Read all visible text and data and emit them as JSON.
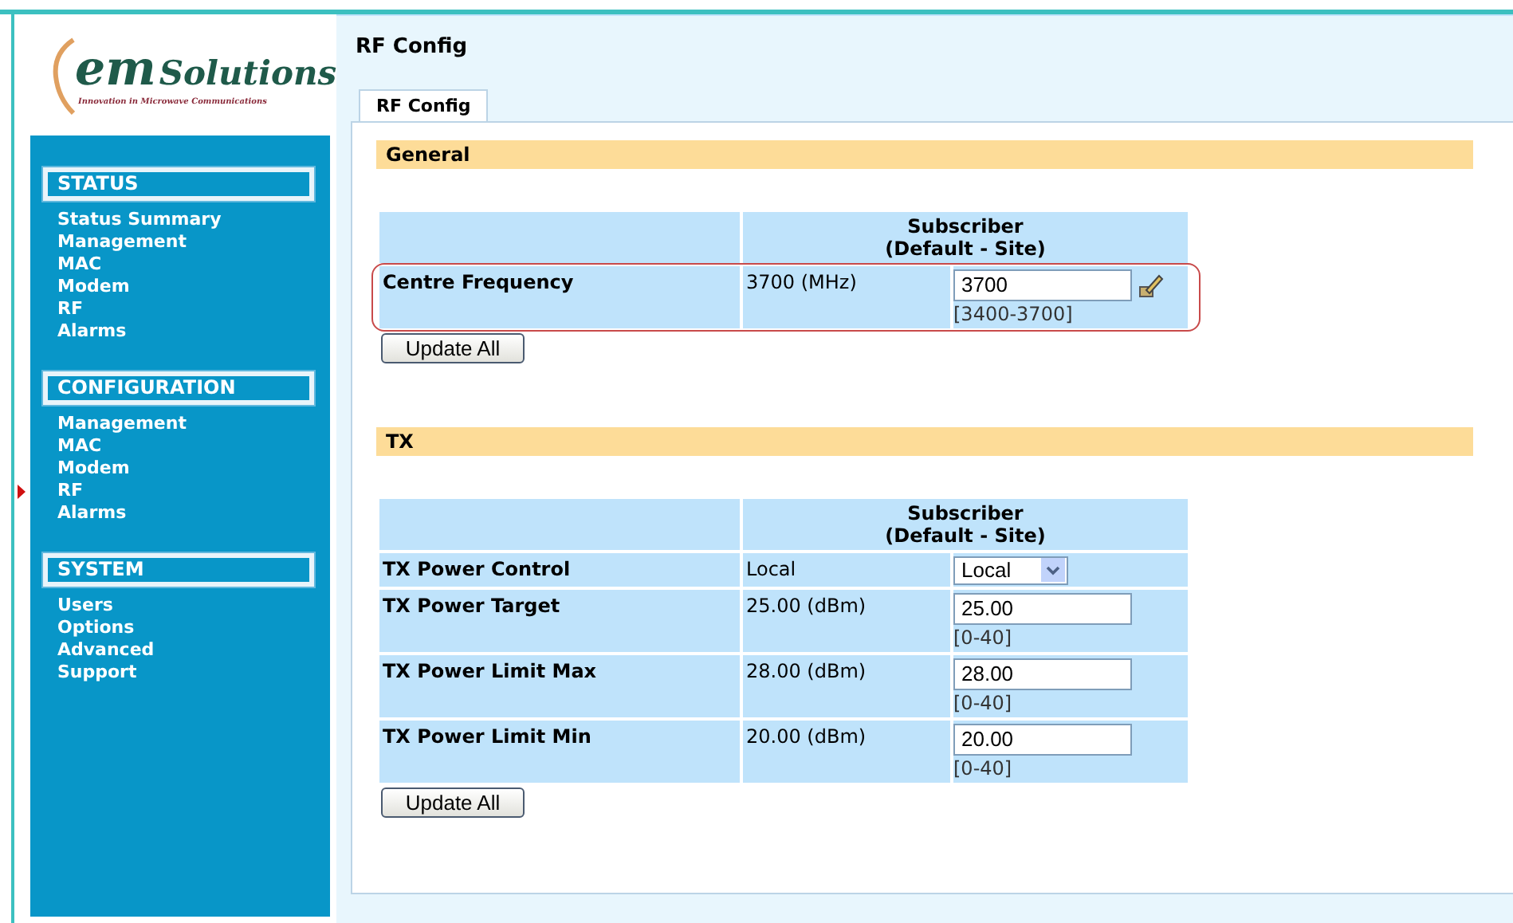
{
  "logo": {
    "brand_mark": "em",
    "brand_name": "Solutions",
    "tagline": "Innovation in Microwave Communications"
  },
  "sidebar": {
    "sections": [
      {
        "title": "STATUS",
        "items": [
          {
            "label": "Status Summary",
            "selected": false
          },
          {
            "label": "Management",
            "selected": false
          },
          {
            "label": "MAC",
            "selected": false
          },
          {
            "label": "Modem",
            "selected": false
          },
          {
            "label": "RF",
            "selected": false
          },
          {
            "label": "Alarms",
            "selected": false
          }
        ]
      },
      {
        "title": "CONFIGURATION",
        "items": [
          {
            "label": "Management",
            "selected": false
          },
          {
            "label": "MAC",
            "selected": false
          },
          {
            "label": "Modem",
            "selected": false
          },
          {
            "label": "RF",
            "selected": true
          },
          {
            "label": "Alarms",
            "selected": false
          }
        ]
      },
      {
        "title": "SYSTEM",
        "items": [
          {
            "label": "Users",
            "selected": false
          },
          {
            "label": "Options",
            "selected": false
          },
          {
            "label": "Advanced",
            "selected": false
          },
          {
            "label": "Support",
            "selected": false
          }
        ]
      }
    ]
  },
  "page_title": "RF Config",
  "tabs": [
    {
      "label": "RF Config",
      "selected": true
    }
  ],
  "sections": [
    {
      "title": "General",
      "column_header": "Subscriber\n(Default - Site)",
      "highlighted": true,
      "rows": [
        {
          "kind": "input",
          "label": "Centre Frequency",
          "current": "3700 (MHz)",
          "value": "3700",
          "range": "[3400-3700]",
          "edit_icon": true
        }
      ],
      "button": "Update All"
    },
    {
      "title": "TX",
      "column_header": "Subscriber\n(Default - Site)",
      "highlighted": false,
      "rows": [
        {
          "kind": "select",
          "label": "TX Power Control",
          "current": "Local",
          "value": "Local"
        },
        {
          "kind": "input",
          "label": "TX Power Target",
          "current": "25.00 (dBm)",
          "value": "25.00",
          "range": "[0-40]",
          "edit_icon": false
        },
        {
          "kind": "input",
          "label": "TX Power Limit Max",
          "current": "28.00 (dBm)",
          "value": "28.00",
          "range": "[0-40]",
          "edit_icon": false
        },
        {
          "kind": "input",
          "label": "TX Power Limit Min",
          "current": "20.00 (dBm)",
          "value": "20.00",
          "range": "[0-40]",
          "edit_icon": false
        }
      ],
      "button": "Update All"
    }
  ]
}
